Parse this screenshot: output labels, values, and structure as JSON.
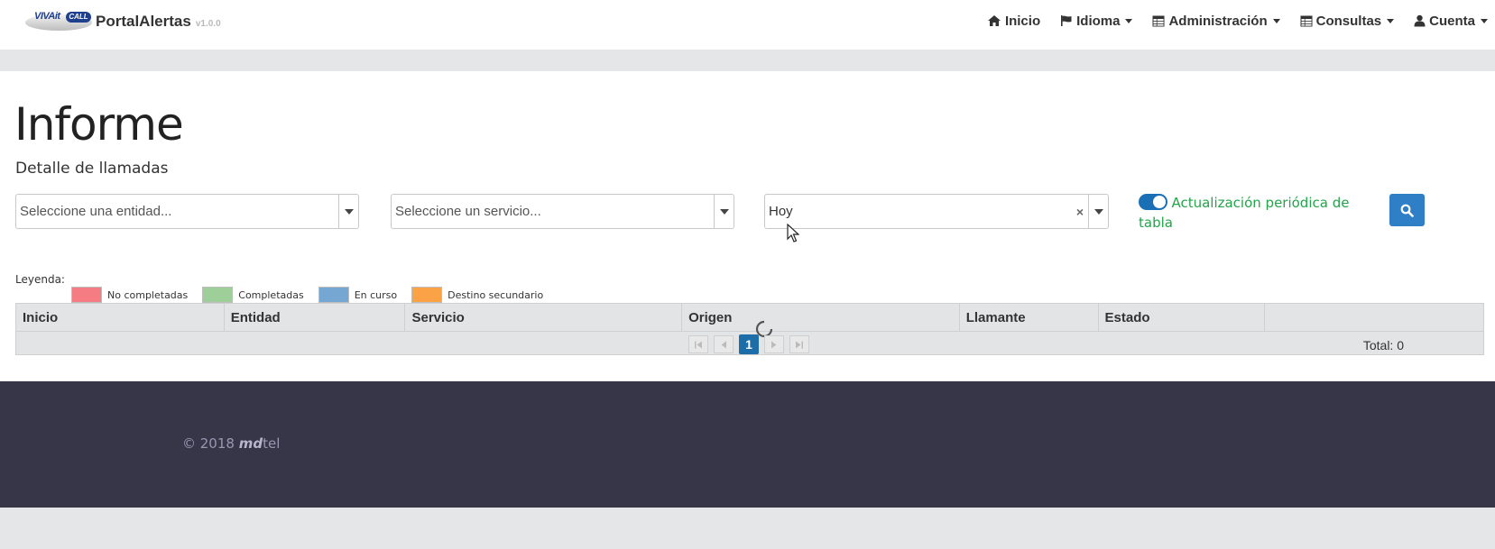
{
  "brand": {
    "logo_text": "VIVAit CALL",
    "logo_viva": "VIVAit",
    "logo_call": "CALL",
    "name": "PortalAlertas",
    "version": "v1.0.0"
  },
  "nav": {
    "home": "Inicio",
    "language": "Idioma",
    "admin": "Administración",
    "queries": "Consultas",
    "account": "Cuenta"
  },
  "page": {
    "title": "Informe",
    "subtitle": "Detalle de llamadas"
  },
  "filters": {
    "entity_placeholder": "Seleccione una entidad...",
    "service_placeholder": "Seleccione un servicio...",
    "period_value": "Hoy",
    "auto_refresh_label": "Actualización periódica de tabla",
    "auto_refresh_on": true
  },
  "legend": {
    "label": "Leyenda:",
    "items": [
      {
        "label": "No completadas",
        "color": "#f47c82"
      },
      {
        "label": "Completadas",
        "color": "#9fcf98"
      },
      {
        "label": "En curso",
        "color": "#76a7d3"
      },
      {
        "label": "Destino secundario",
        "color": "#fba246"
      }
    ]
  },
  "table": {
    "columns": [
      "Inicio",
      "Entidad",
      "Servicio",
      "Origen",
      "Llamante",
      "Estado",
      ""
    ],
    "current_page": "1",
    "total_label": "Total: 0"
  },
  "footer": {
    "copyright": "© 2018",
    "company_md": "md",
    "company_tel": "tel"
  },
  "colors": {
    "primary": "#2f7fc6",
    "footer_bg": "#373548",
    "toggle_on": "#1a6fb5",
    "toggle_label": "#23a44a"
  }
}
